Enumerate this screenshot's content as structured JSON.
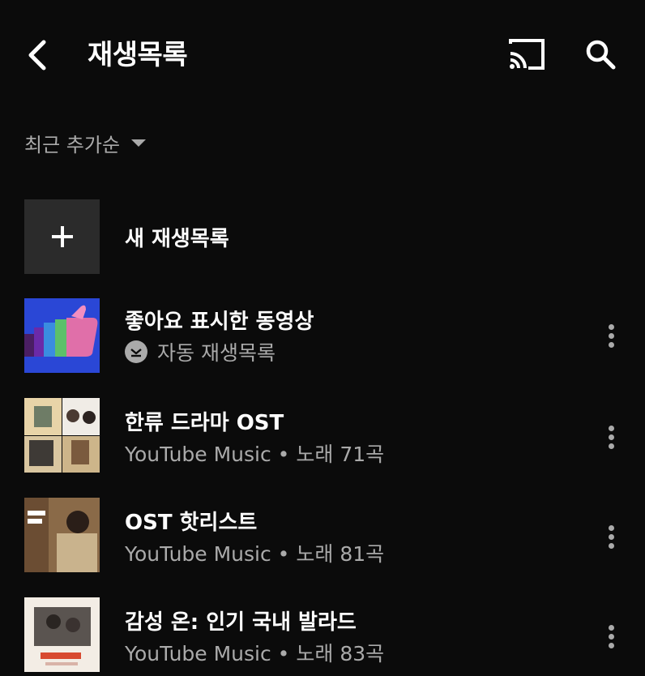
{
  "header": {
    "title": "재생목록",
    "icons": [
      "back-icon",
      "cast-icon",
      "search-icon"
    ]
  },
  "sort": {
    "label": "최근 추가순"
  },
  "new_playlist": {
    "label": "새 재생목록"
  },
  "playlists": [
    {
      "title": "좋아요 표시한 동영상",
      "subtitle": "자동 재생목록",
      "thumb_colors": [
        "#2a47d6",
        "#e06fa9",
        "#5cc06a"
      ]
    },
    {
      "title": "한류 드라마 OST",
      "subtitle": "YouTube Music • 노래 71곡",
      "thumb_colors": [
        "#e8d4a8",
        "#cdb58a"
      ]
    },
    {
      "title": "OST 핫리스트",
      "subtitle": "YouTube Music • 노래 81곡",
      "thumb_colors": [
        "#6b4d33",
        "#c9b38d"
      ]
    },
    {
      "title": "감성 온: 인기 국내 발라드",
      "subtitle": "YouTube Music • 노래 83곡",
      "thumb_colors": [
        "#f3ede5",
        "#d84a30"
      ]
    }
  ],
  "colors": {
    "background": "#0b0b0b",
    "text": "#ffffff",
    "secondary": "#aaaaaa"
  }
}
